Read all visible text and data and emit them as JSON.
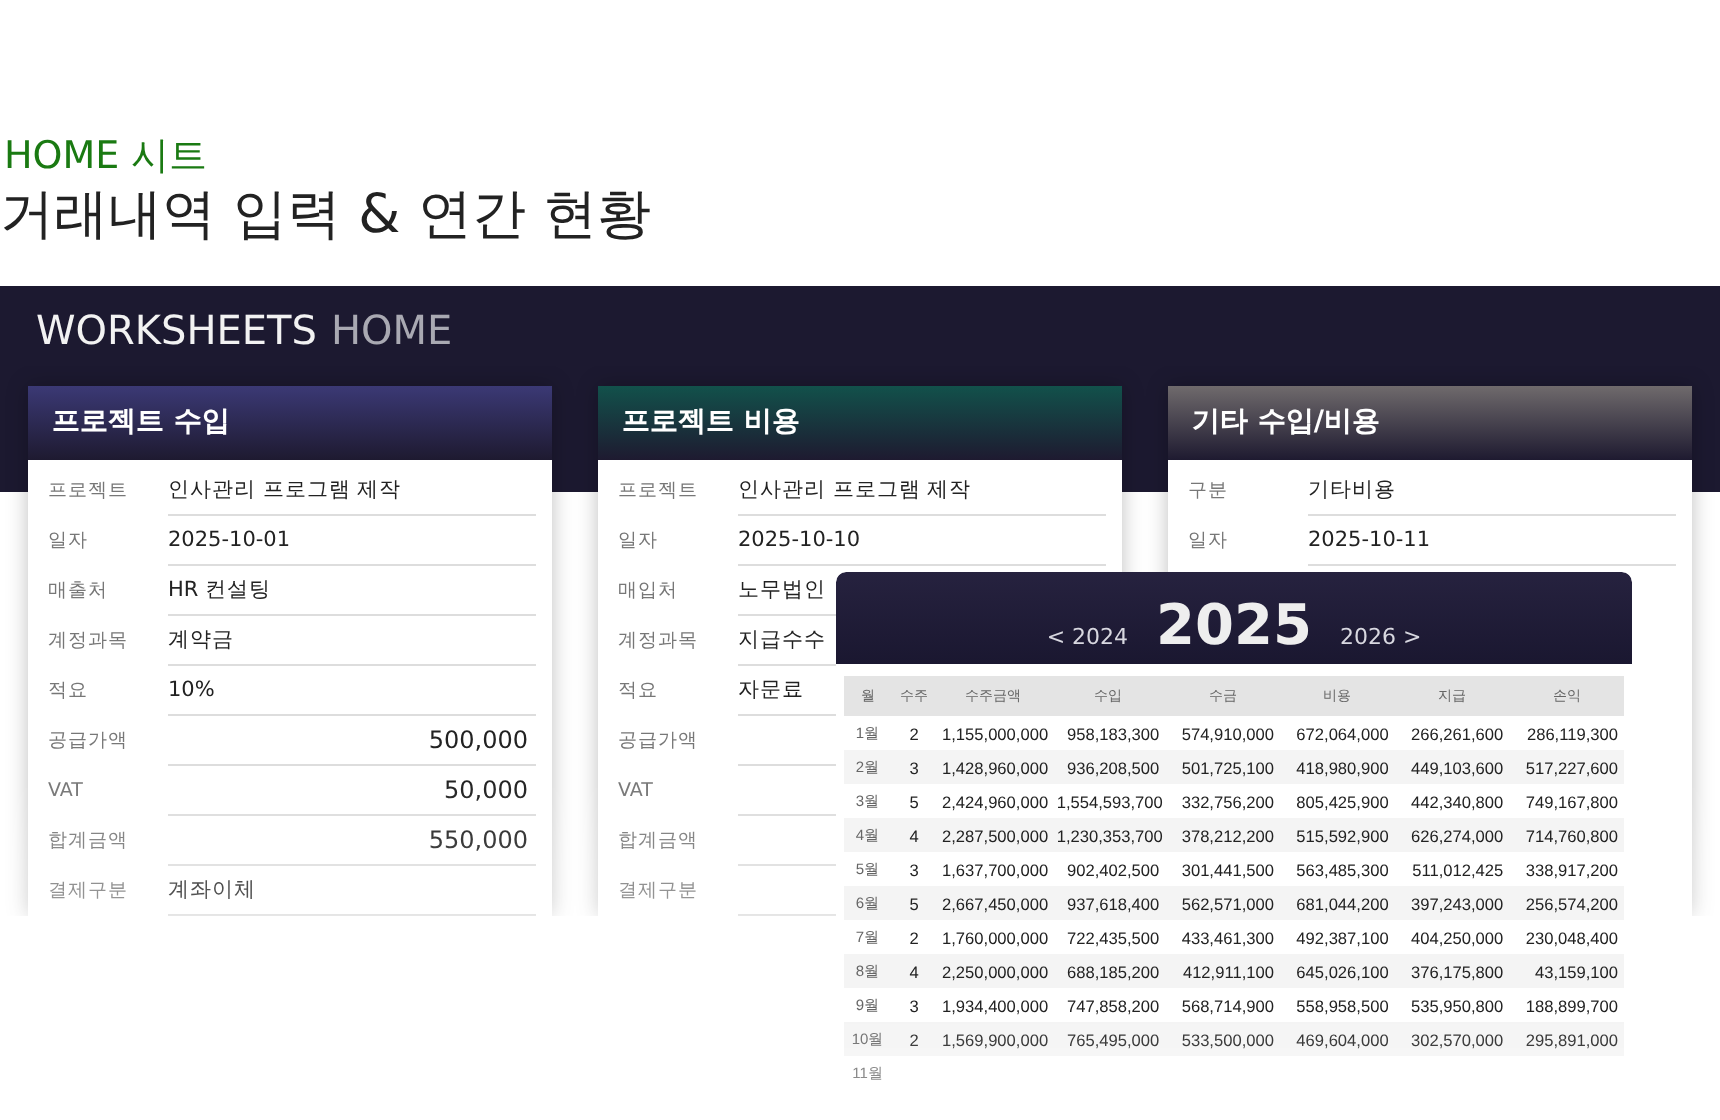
{
  "page": {
    "subtitle": "HOME 시트",
    "title": "거래내역 입력 & 연간 현황"
  },
  "banner": {
    "title": "WORKSHEETS",
    "title_accent": "HOME"
  },
  "cards": [
    {
      "title": "프로젝트 수입",
      "color": "#3b3975",
      "rows": [
        {
          "label": "프로젝트",
          "value": "인사관리 프로그램 제작",
          "kind": "text"
        },
        {
          "label": "일자",
          "value": "2025-10-01",
          "kind": "text"
        },
        {
          "label": "매출처",
          "value": "HR 컨설팅",
          "kind": "text"
        },
        {
          "label": "계정과목",
          "value": "계약금",
          "kind": "text"
        },
        {
          "label": "적요",
          "value": "10%",
          "kind": "text"
        },
        {
          "label": "공급가액",
          "value": "500,000",
          "kind": "amount"
        },
        {
          "label": "VAT",
          "value": "50,000",
          "kind": "amount"
        },
        {
          "label": "합계금액",
          "value": "550,000",
          "kind": "amount"
        },
        {
          "label": "결제구분",
          "value": "계좌이체",
          "kind": "text"
        }
      ]
    },
    {
      "title": "프로젝트 비용",
      "color": "#12514b",
      "rows": [
        {
          "label": "프로젝트",
          "value": "인사관리 프로그램 제작",
          "kind": "text"
        },
        {
          "label": "일자",
          "value": "2025-10-10",
          "kind": "text"
        },
        {
          "label": "매입처",
          "value": "노무법인",
          "kind": "text"
        },
        {
          "label": "계정과목",
          "value": "지급수수",
          "kind": "text"
        },
        {
          "label": "적요",
          "value": "자문료",
          "kind": "text"
        },
        {
          "label": "공급가액",
          "kind": "amount"
        },
        {
          "label": "VAT",
          "kind": "amount"
        },
        {
          "label": "합계금액",
          "kind": "amount"
        },
        {
          "label": "결제구분",
          "kind": "text"
        }
      ]
    },
    {
      "title": "기타 수입/비용",
      "color": "#6f6a6c",
      "rows": [
        {
          "label": "구분",
          "value": "기타비용",
          "kind": "text"
        },
        {
          "label": "일자",
          "value": "2025-10-11",
          "kind": "text"
        }
      ]
    }
  ],
  "annual": {
    "prev_year": "< 2024",
    "year": "2025",
    "next_year": "2026 >",
    "columns": [
      "월",
      "수주",
      "수주금액",
      "수입",
      "수금",
      "비용",
      "지급",
      "손익"
    ],
    "rows": [
      [
        "1월",
        "2",
        "1,155,000,000",
        "958,183,300",
        "574,910,000",
        "672,064,000",
        "266,261,600",
        "286,119,300"
      ],
      [
        "2월",
        "3",
        "1,428,960,000",
        "936,208,500",
        "501,725,100",
        "418,980,900",
        "449,103,600",
        "517,227,600"
      ],
      [
        "3월",
        "5",
        "2,424,960,000",
        "1,554,593,700",
        "332,756,200",
        "805,425,900",
        "442,340,800",
        "749,167,800"
      ],
      [
        "4월",
        "4",
        "2,287,500,000",
        "1,230,353,700",
        "378,212,200",
        "515,592,900",
        "626,274,000",
        "714,760,800"
      ],
      [
        "5월",
        "3",
        "1,637,700,000",
        "902,402,500",
        "301,441,500",
        "563,485,300",
        "511,012,425",
        "338,917,200"
      ],
      [
        "6월",
        "5",
        "2,667,450,000",
        "937,618,400",
        "562,571,000",
        "681,044,200",
        "397,243,000",
        "256,574,200"
      ],
      [
        "7월",
        "2",
        "1,760,000,000",
        "722,435,500",
        "433,461,300",
        "492,387,100",
        "404,250,000",
        "230,048,400"
      ],
      [
        "8월",
        "4",
        "2,250,000,000",
        "688,185,200",
        "412,911,100",
        "645,026,100",
        "376,175,800",
        "43,159,100"
      ],
      [
        "9월",
        "3",
        "1,934,400,000",
        "747,858,200",
        "568,714,900",
        "558,958,500",
        "535,950,800",
        "188,899,700"
      ],
      [
        "10월",
        "2",
        "1,569,900,000",
        "765,495,000",
        "533,500,000",
        "469,604,000",
        "302,570,000",
        "295,891,000"
      ],
      [
        "11월"
      ]
    ]
  }
}
